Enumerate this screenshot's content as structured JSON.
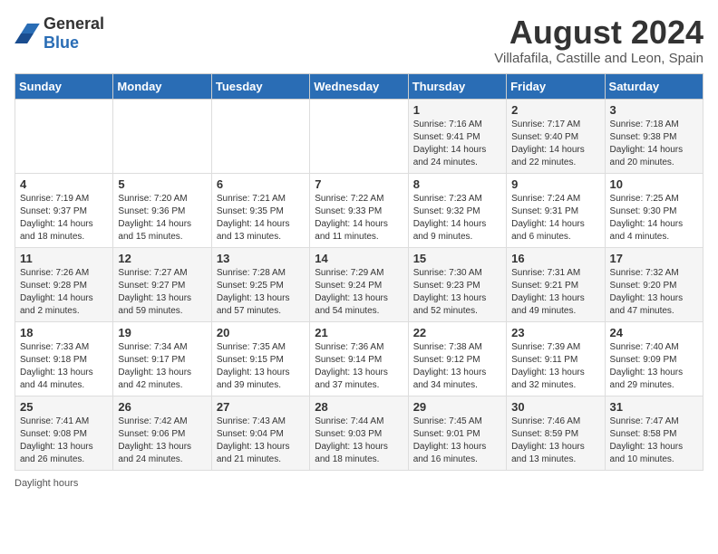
{
  "header": {
    "logo_general": "General",
    "logo_blue": "Blue",
    "month_year": "August 2024",
    "location": "Villafafila, Castille and Leon, Spain"
  },
  "weekdays": [
    "Sunday",
    "Monday",
    "Tuesday",
    "Wednesday",
    "Thursday",
    "Friday",
    "Saturday"
  ],
  "weeks": [
    [
      {
        "day": "",
        "info": ""
      },
      {
        "day": "",
        "info": ""
      },
      {
        "day": "",
        "info": ""
      },
      {
        "day": "",
        "info": ""
      },
      {
        "day": "1",
        "info": "Sunrise: 7:16 AM\nSunset: 9:41 PM\nDaylight: 14 hours and 24 minutes."
      },
      {
        "day": "2",
        "info": "Sunrise: 7:17 AM\nSunset: 9:40 PM\nDaylight: 14 hours and 22 minutes."
      },
      {
        "day": "3",
        "info": "Sunrise: 7:18 AM\nSunset: 9:38 PM\nDaylight: 14 hours and 20 minutes."
      }
    ],
    [
      {
        "day": "4",
        "info": "Sunrise: 7:19 AM\nSunset: 9:37 PM\nDaylight: 14 hours and 18 minutes."
      },
      {
        "day": "5",
        "info": "Sunrise: 7:20 AM\nSunset: 9:36 PM\nDaylight: 14 hours and 15 minutes."
      },
      {
        "day": "6",
        "info": "Sunrise: 7:21 AM\nSunset: 9:35 PM\nDaylight: 14 hours and 13 minutes."
      },
      {
        "day": "7",
        "info": "Sunrise: 7:22 AM\nSunset: 9:33 PM\nDaylight: 14 hours and 11 minutes."
      },
      {
        "day": "8",
        "info": "Sunrise: 7:23 AM\nSunset: 9:32 PM\nDaylight: 14 hours and 9 minutes."
      },
      {
        "day": "9",
        "info": "Sunrise: 7:24 AM\nSunset: 9:31 PM\nDaylight: 14 hours and 6 minutes."
      },
      {
        "day": "10",
        "info": "Sunrise: 7:25 AM\nSunset: 9:30 PM\nDaylight: 14 hours and 4 minutes."
      }
    ],
    [
      {
        "day": "11",
        "info": "Sunrise: 7:26 AM\nSunset: 9:28 PM\nDaylight: 14 hours and 2 minutes."
      },
      {
        "day": "12",
        "info": "Sunrise: 7:27 AM\nSunset: 9:27 PM\nDaylight: 13 hours and 59 minutes."
      },
      {
        "day": "13",
        "info": "Sunrise: 7:28 AM\nSunset: 9:25 PM\nDaylight: 13 hours and 57 minutes."
      },
      {
        "day": "14",
        "info": "Sunrise: 7:29 AM\nSunset: 9:24 PM\nDaylight: 13 hours and 54 minutes."
      },
      {
        "day": "15",
        "info": "Sunrise: 7:30 AM\nSunset: 9:23 PM\nDaylight: 13 hours and 52 minutes."
      },
      {
        "day": "16",
        "info": "Sunrise: 7:31 AM\nSunset: 9:21 PM\nDaylight: 13 hours and 49 minutes."
      },
      {
        "day": "17",
        "info": "Sunrise: 7:32 AM\nSunset: 9:20 PM\nDaylight: 13 hours and 47 minutes."
      }
    ],
    [
      {
        "day": "18",
        "info": "Sunrise: 7:33 AM\nSunset: 9:18 PM\nDaylight: 13 hours and 44 minutes."
      },
      {
        "day": "19",
        "info": "Sunrise: 7:34 AM\nSunset: 9:17 PM\nDaylight: 13 hours and 42 minutes."
      },
      {
        "day": "20",
        "info": "Sunrise: 7:35 AM\nSunset: 9:15 PM\nDaylight: 13 hours and 39 minutes."
      },
      {
        "day": "21",
        "info": "Sunrise: 7:36 AM\nSunset: 9:14 PM\nDaylight: 13 hours and 37 minutes."
      },
      {
        "day": "22",
        "info": "Sunrise: 7:38 AM\nSunset: 9:12 PM\nDaylight: 13 hours and 34 minutes."
      },
      {
        "day": "23",
        "info": "Sunrise: 7:39 AM\nSunset: 9:11 PM\nDaylight: 13 hours and 32 minutes."
      },
      {
        "day": "24",
        "info": "Sunrise: 7:40 AM\nSunset: 9:09 PM\nDaylight: 13 hours and 29 minutes."
      }
    ],
    [
      {
        "day": "25",
        "info": "Sunrise: 7:41 AM\nSunset: 9:08 PM\nDaylight: 13 hours and 26 minutes."
      },
      {
        "day": "26",
        "info": "Sunrise: 7:42 AM\nSunset: 9:06 PM\nDaylight: 13 hours and 24 minutes."
      },
      {
        "day": "27",
        "info": "Sunrise: 7:43 AM\nSunset: 9:04 PM\nDaylight: 13 hours and 21 minutes."
      },
      {
        "day": "28",
        "info": "Sunrise: 7:44 AM\nSunset: 9:03 PM\nDaylight: 13 hours and 18 minutes."
      },
      {
        "day": "29",
        "info": "Sunrise: 7:45 AM\nSunset: 9:01 PM\nDaylight: 13 hours and 16 minutes."
      },
      {
        "day": "30",
        "info": "Sunrise: 7:46 AM\nSunset: 8:59 PM\nDaylight: 13 hours and 13 minutes."
      },
      {
        "day": "31",
        "info": "Sunrise: 7:47 AM\nSunset: 8:58 PM\nDaylight: 13 hours and 10 minutes."
      }
    ]
  ],
  "footer": {
    "daylight_label": "Daylight hours"
  }
}
